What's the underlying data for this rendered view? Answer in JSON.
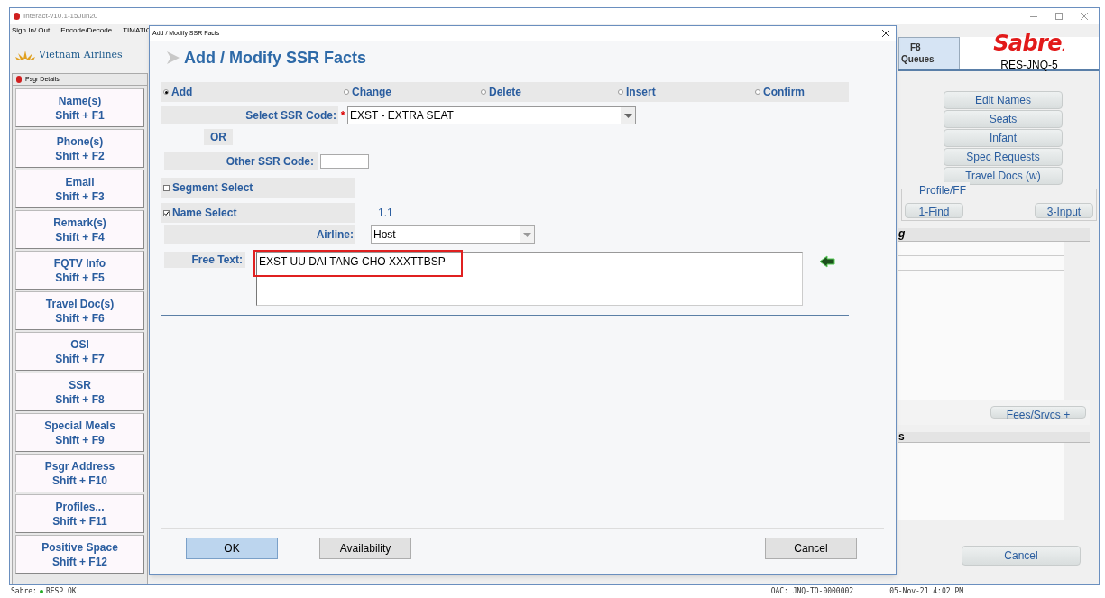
{
  "window": {
    "title": "Interact-v10.1-15Jun20"
  },
  "menu": [
    "Sign In/ Out",
    "Encode/Decode",
    "TIMATIC"
  ],
  "sidebar": {
    "logo": "Vietnam Airlines",
    "panel_title": "Psgr Details",
    "items": [
      {
        "label": "Name(s)",
        "shortcut": "Shift + F1"
      },
      {
        "label": "Phone(s)",
        "shortcut": "Shift + F2"
      },
      {
        "label": "Email",
        "shortcut": "Shift + F3"
      },
      {
        "label": "Remark(s)",
        "shortcut": "Shift + F4"
      },
      {
        "label": "FQTV Info",
        "shortcut": "Shift + F5"
      },
      {
        "label": "Travel Doc(s)",
        "shortcut": "Shift + F6"
      },
      {
        "label": "OSI",
        "shortcut": "Shift + F7"
      },
      {
        "label": "SSR",
        "shortcut": "Shift + F8"
      },
      {
        "label": "Special Meals",
        "shortcut": "Shift + F9"
      },
      {
        "label": "Psgr Address",
        "shortcut": "Shift + F10"
      },
      {
        "label": "Profiles...",
        "shortcut": "Shift + F11"
      },
      {
        "label": "Positive Space",
        "shortcut": "Shift + F12"
      }
    ]
  },
  "right_panel": {
    "queues_button": {
      "key": "F8",
      "label": "Queues"
    },
    "brand": "Sabre",
    "brand_mark": ".",
    "station": "RES-JNQ-5",
    "buttons": [
      "Edit Names",
      "Seats",
      "Infant",
      "Spec Requests",
      "Travel Docs (w)"
    ],
    "profile_group": {
      "title": "Profile/FF",
      "buttons": [
        "1-Find",
        "3-Input"
      ]
    },
    "section_1_header": "g",
    "fees_button": "Fees/Srvcs +",
    "section_2_header": "s",
    "cancel_button": "Cancel"
  },
  "dialog": {
    "title": "Add / Modify SSR Facts",
    "heading": "Add / Modify SSR Facts",
    "actions": [
      {
        "label": "Add",
        "selected": true
      },
      {
        "label": "Change",
        "selected": false
      },
      {
        "label": "Delete",
        "selected": false
      },
      {
        "label": "Insert",
        "selected": false
      },
      {
        "label": "Confirm",
        "selected": false
      }
    ],
    "ssr_code": {
      "label": "Select SSR Code:",
      "required_mark": "*",
      "value": "EXST - EXTRA SEAT"
    },
    "or_label": "OR",
    "other_ssr_code": {
      "label": "Other SSR Code:"
    },
    "segment_select": {
      "label": "Segment Select",
      "checked": false
    },
    "name_select": {
      "label": "Name Select",
      "checked": true,
      "value": "1.1"
    },
    "airline": {
      "label": "Airline:",
      "value": "Host"
    },
    "free_text": {
      "label": "Free Text:",
      "value": "EXST UU DAI TANG CHO XXXTTBSP"
    },
    "buttons": [
      {
        "label": "OK",
        "default": true
      },
      {
        "label": "Availability",
        "default": false
      },
      {
        "label": "Cancel",
        "default": false
      }
    ]
  },
  "status_bar": {
    "left_label": "Sabre:",
    "left_status": "RESP OK",
    "office": "OAC: JNQ-TO-0000002",
    "datetime": "05-Nov-21 4:02 PM"
  }
}
